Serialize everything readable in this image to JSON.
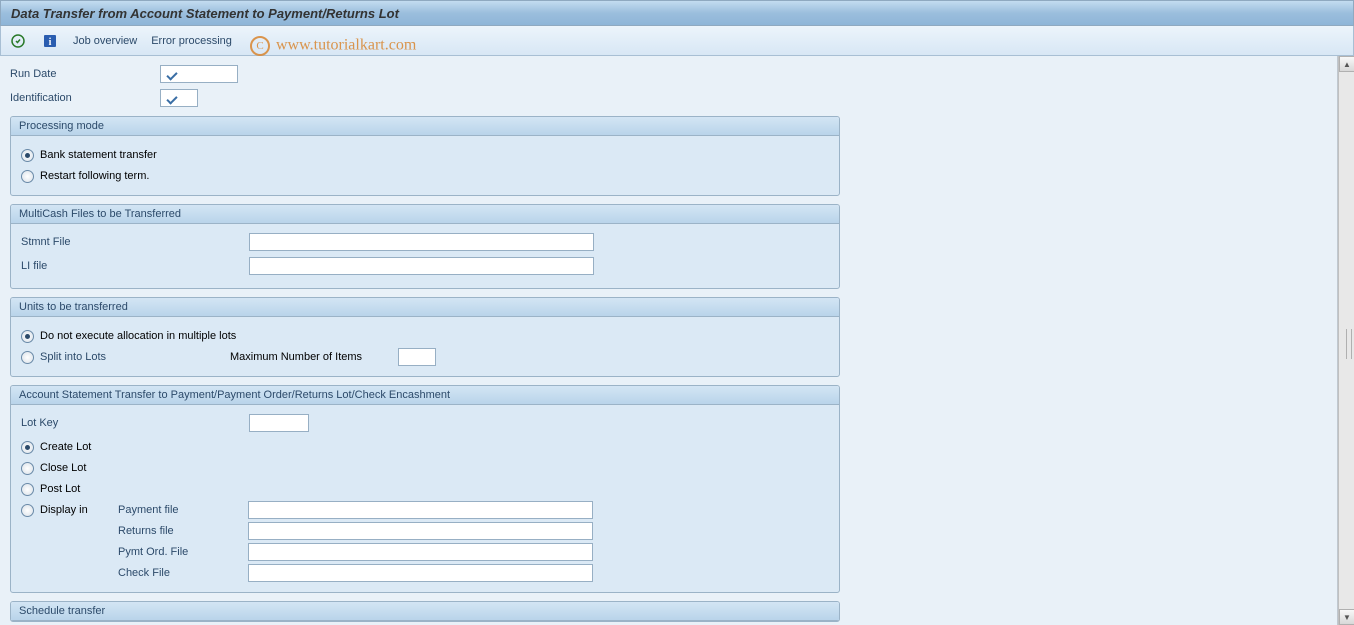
{
  "title": "Data Transfer from Account Statement to Payment/Returns Lot",
  "toolbar": {
    "job_overview": "Job overview",
    "error_processing": "Error processing"
  },
  "watermark": "www.tutorialkart.com",
  "fields": {
    "run_date_label": "Run Date",
    "run_date_value": "",
    "identification_label": "Identification",
    "identification_value": ""
  },
  "processing_mode": {
    "header": "Processing mode",
    "opt1": "Bank statement transfer",
    "opt2": "Restart following term."
  },
  "multicash": {
    "header": "MultiCash Files to be Transferred",
    "stmnt_label": "Stmnt File",
    "stmnt_value": "",
    "li_label": "LI file",
    "li_value": ""
  },
  "units": {
    "header": "Units to be transferred",
    "opt1": "Do not execute allocation in multiple lots",
    "opt2": "Split into Lots",
    "max_label": "Maximum Number of Items",
    "max_value": ""
  },
  "account_transfer": {
    "header": "Account Statement Transfer to Payment/Payment Order/Returns Lot/Check Encashment",
    "lot_key_label": "Lot Key",
    "lot_key_value": "",
    "create_lot": "Create Lot",
    "close_lot": "Close Lot",
    "post_lot": "Post Lot",
    "display_in": "Display in",
    "payment_file_label": "Payment file",
    "payment_file_value": "",
    "returns_file_label": "Returns file",
    "returns_file_value": "",
    "pymt_ord_label": "Pymt Ord. File",
    "pymt_ord_value": "",
    "check_file_label": "Check File",
    "check_file_value": ""
  },
  "schedule": {
    "header": "Schedule transfer"
  }
}
